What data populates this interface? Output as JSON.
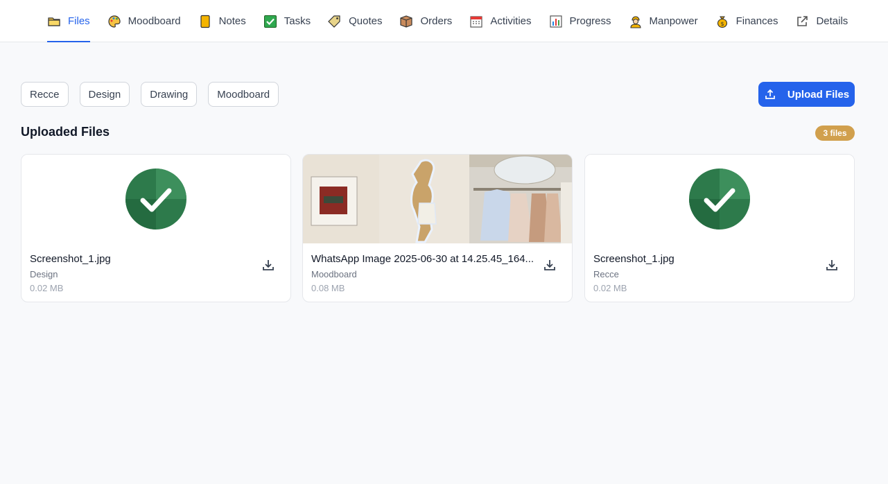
{
  "nav": {
    "tabs": [
      {
        "label": "Files",
        "icon": "folder-icon",
        "active": true
      },
      {
        "label": "Moodboard",
        "icon": "palette-icon"
      },
      {
        "label": "Notes",
        "icon": "notepad-icon"
      },
      {
        "label": "Tasks",
        "icon": "checkbox-icon"
      },
      {
        "label": "Quotes",
        "icon": "tag-icon"
      },
      {
        "label": "Orders",
        "icon": "package-icon"
      },
      {
        "label": "Activities",
        "icon": "calendar-icon"
      },
      {
        "label": "Progress",
        "icon": "bar-chart-icon"
      },
      {
        "label": "Manpower",
        "icon": "worker-icon"
      },
      {
        "label": "Finances",
        "icon": "money-bag-icon"
      },
      {
        "label": "Details",
        "icon": "external-link-icon"
      }
    ]
  },
  "filters": [
    "Recce",
    "Design",
    "Drawing",
    "Moodboard"
  ],
  "upload_label": "Upload Files",
  "section_title": "Uploaded Files",
  "file_count": "3 files",
  "files": [
    {
      "name": "Screenshot_1.jpg",
      "category": "Design",
      "size": "0.02 MB",
      "thumb": "check-icon"
    },
    {
      "name": "WhatsApp Image 2025-06-30 at 14.25.45_164...",
      "category": "Moodboard",
      "size": "0.08 MB",
      "thumb": "photo"
    },
    {
      "name": "Screenshot_1.jpg",
      "category": "Recce",
      "size": "0.02 MB",
      "thumb": "check-icon"
    }
  ],
  "colors": {
    "accent": "#2563eb",
    "badge": "#d1a04d",
    "check_green": "#2d7a4b"
  }
}
